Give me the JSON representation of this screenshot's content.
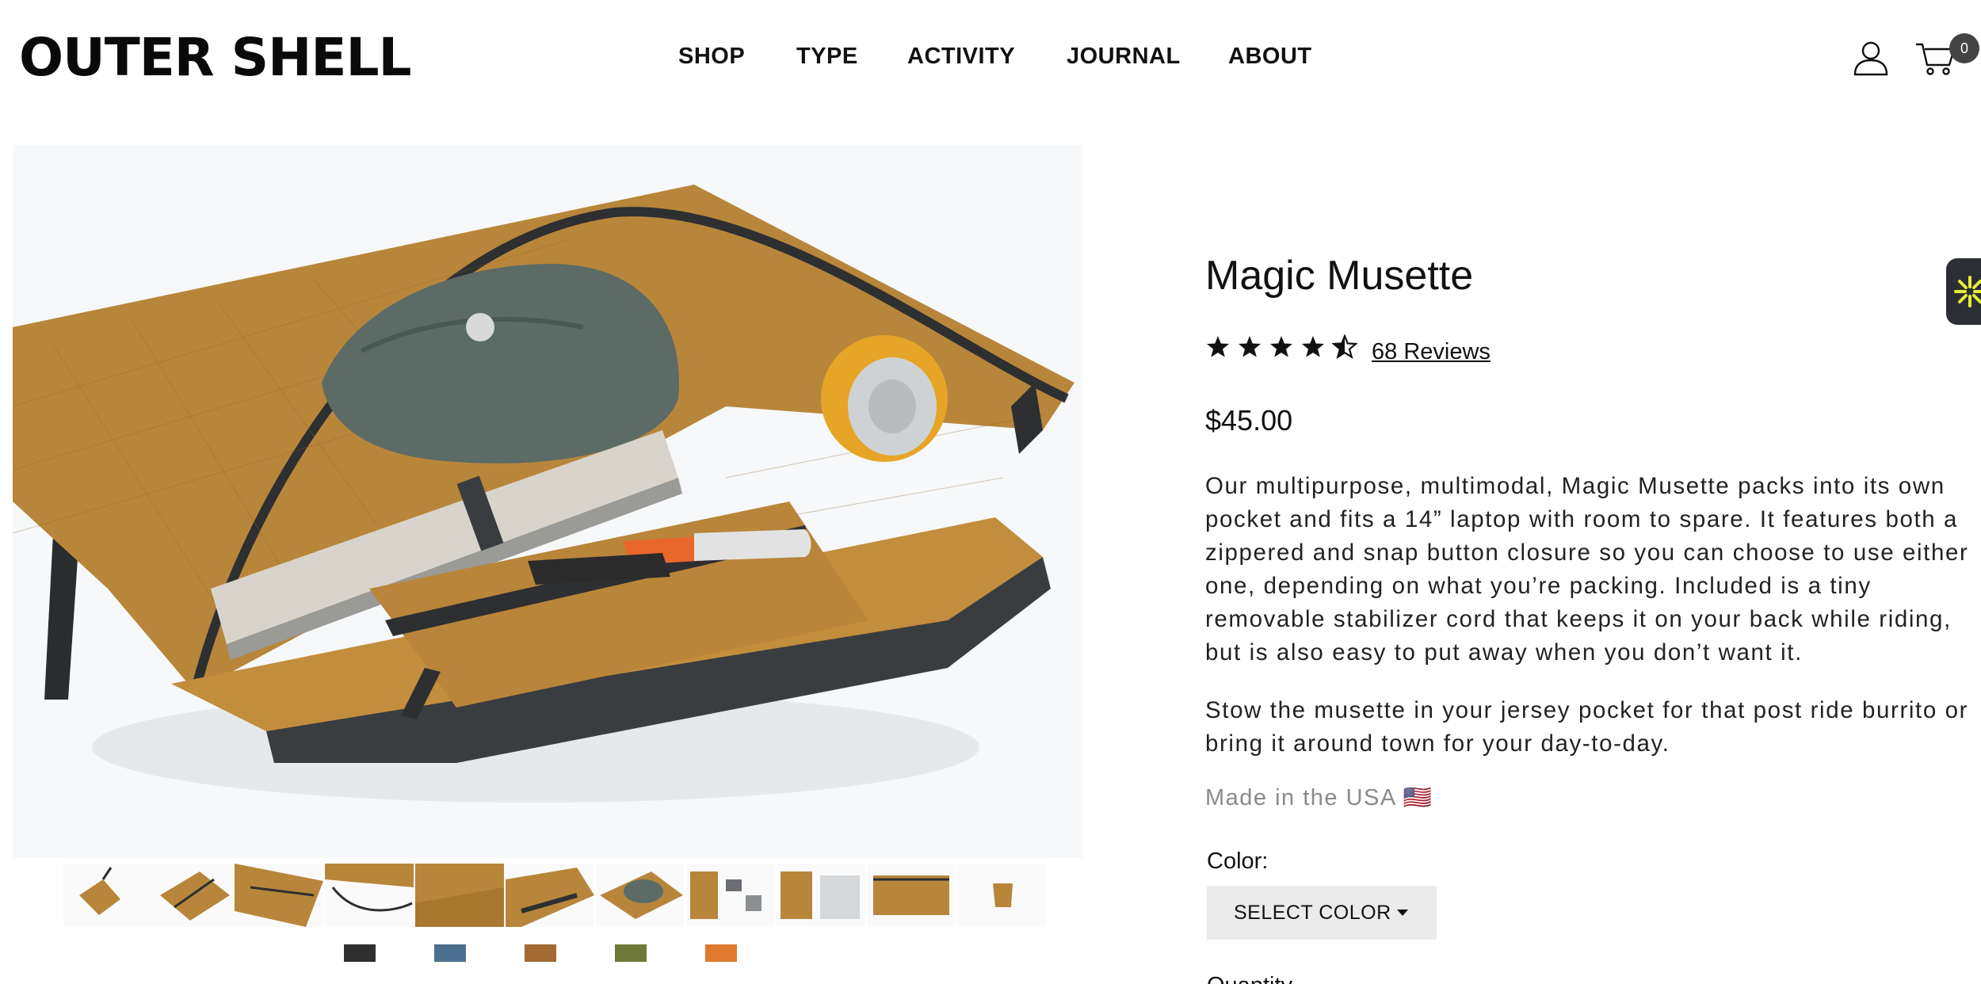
{
  "header": {
    "logo": "OUTER SHELL",
    "nav": [
      "SHOP",
      "TYPE",
      "ACTIVITY",
      "JOURNAL",
      "ABOUT"
    ],
    "cart_count": "0",
    "account_icon": "user-icon",
    "cart_icon": "cart-icon"
  },
  "product": {
    "title": "Magic Musette",
    "rating": 4.5,
    "rating_max": 5,
    "reviews_label": "68 Reviews",
    "price": "$45.00",
    "description_1": "Our multipurpose, multimodal, Magic Musette packs into its own pocket and fits a 14” laptop with room to spare. It features both a zippered and snap button closure so you can choose to use either one, depending on what you’re packing. Included is a tiny removable stabilizer cord that keeps it on your back while riding, but is also easy to put away when you don’t want it.",
    "description_2": "Stow the musette in your jersey pocket for that post ride burrito or bring it around town for your day-to-day.",
    "made_in": "Made in the USA 🇺🇸",
    "color_label": "Color:",
    "select_color": "SELECT COLOR",
    "quantity_label": "Quantity"
  },
  "colors": {
    "bag_tan": "#b8863a",
    "bag_dark": "#3a3d40",
    "swatches": [
      "#2f2f2f",
      "#4d6f8f",
      "#a36a34",
      "#6f7a3a",
      "#e07a2e"
    ],
    "widget_accent": "#e5ec3a"
  }
}
